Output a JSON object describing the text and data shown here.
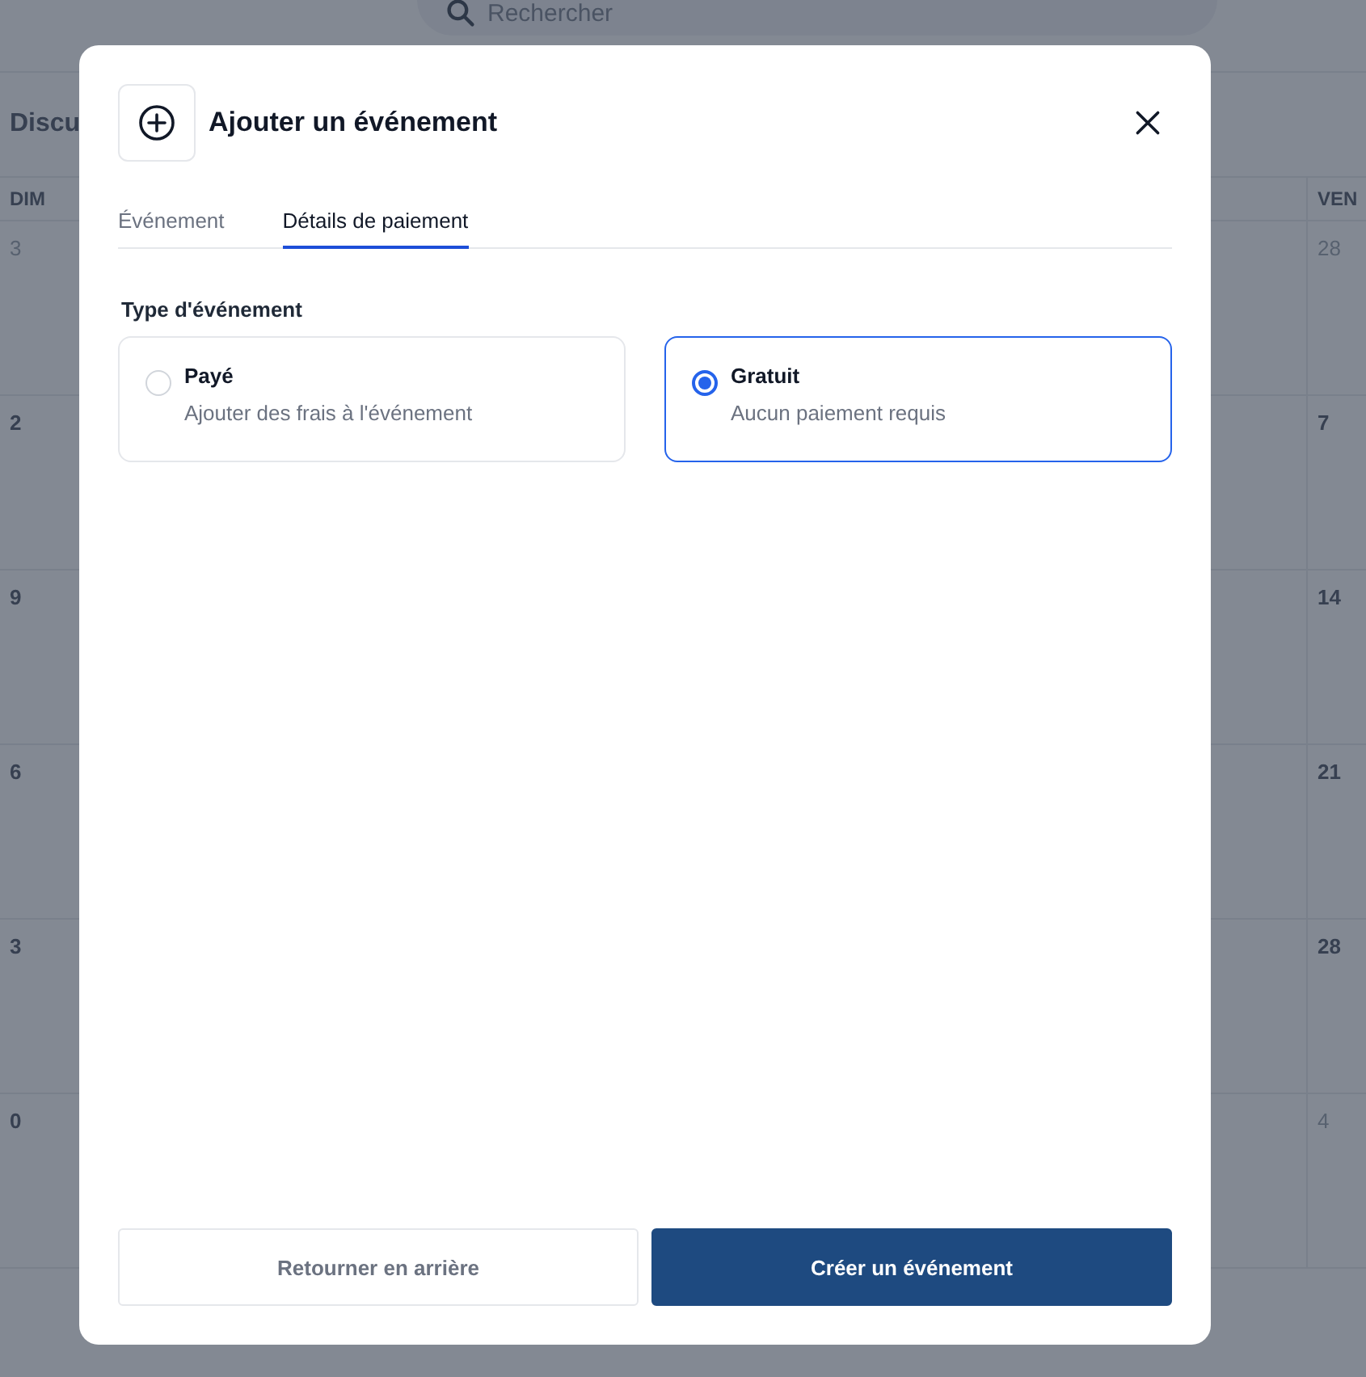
{
  "background": {
    "search_placeholder": "Rechercher",
    "heading": "Discu",
    "weekdays": [
      "DIM",
      "VEN"
    ],
    "weeks": [
      {
        "left": {
          "day": "3",
          "outside_month": true
        },
        "right": {
          "day": "28",
          "outside_month": true
        }
      },
      {
        "left": {
          "day": "2",
          "outside_month": false
        },
        "right": {
          "day": "7",
          "outside_month": false
        }
      },
      {
        "left": {
          "day": "9",
          "outside_month": false
        },
        "right": {
          "day": "14",
          "outside_month": false
        }
      },
      {
        "left": {
          "day": "6",
          "outside_month": false
        },
        "right": {
          "day": "21",
          "outside_month": false
        }
      },
      {
        "left": {
          "day": "3",
          "outside_month": false
        },
        "right": {
          "day": "28",
          "outside_month": false
        }
      },
      {
        "left": {
          "day": "0",
          "outside_month": false
        },
        "right": {
          "day": "4",
          "outside_month": true
        }
      }
    ]
  },
  "dialog": {
    "title": "Ajouter un événement",
    "tabs": [
      {
        "label": "Événement",
        "selected": false
      },
      {
        "label": "Détails de paiement",
        "selected": true
      }
    ],
    "field_label": "Type d'événement",
    "options": [
      {
        "title": "Payé",
        "description": "Ajouter des frais à l'événement",
        "selected": false
      },
      {
        "title": "Gratuit",
        "description": "Aucun paiement requis",
        "selected": true
      }
    ],
    "buttons": [
      {
        "label": "Retourner en arrière",
        "kind": "secondary"
      },
      {
        "label": "Créer un événement",
        "kind": "primary"
      }
    ]
  }
}
